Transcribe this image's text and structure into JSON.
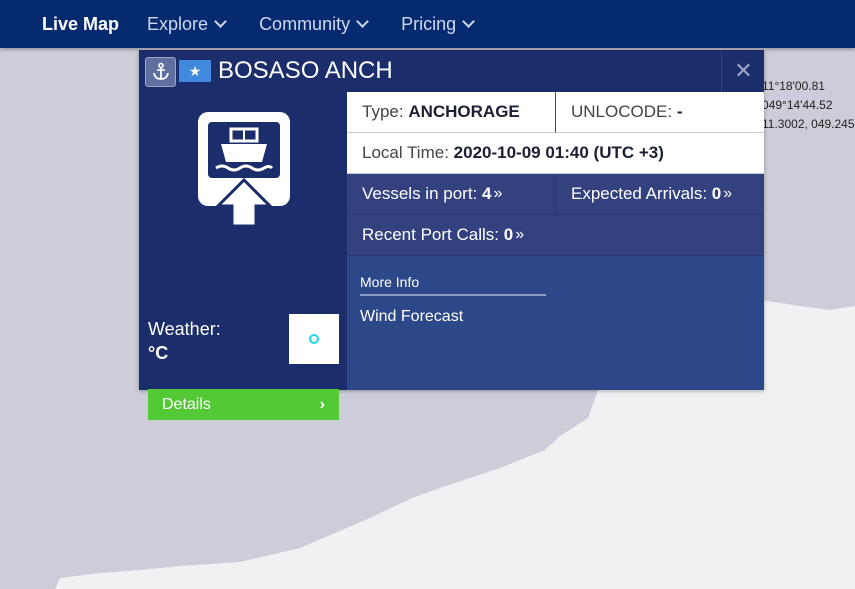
{
  "nav": {
    "items": [
      {
        "label": "Live Map",
        "active": true,
        "dropdown": false
      },
      {
        "label": "Explore",
        "active": false,
        "dropdown": true
      },
      {
        "label": "Community",
        "active": false,
        "dropdown": true
      },
      {
        "label": "Pricing",
        "active": false,
        "dropdown": true
      }
    ]
  },
  "map": {
    "coords": [
      "11°18'00.81",
      "049°14'44.52",
      "11.3002, 049.245"
    ],
    "sea_color": "#cdcdd9",
    "land_color": "#f1f1f3"
  },
  "popup": {
    "port_name": "BOSASO ANCH",
    "type_label": "Type:",
    "type_value": "ANCHORAGE",
    "unlocode_label": "UNLOCODE:",
    "unlocode_value": "-",
    "local_time_label": "Local Time:",
    "local_time_value": "2020-10-09 01:40 (UTC +3)",
    "vessels_label": "Vessels in port:",
    "vessels_value": "4",
    "arrivals_label": "Expected Arrivals:",
    "arrivals_value": "0",
    "recent_label": "Recent Port Calls:",
    "recent_value": "0",
    "weather_label": "Weather:",
    "weather_unit": "°C",
    "details_label": "Details",
    "more_info_label": "More Info",
    "wind_forecast_label": "Wind Forecast",
    "icons": {
      "anchor": "anchor-icon",
      "flag": "somalia-flag-icon",
      "close": "close-icon",
      "port": "port-ship-icon"
    },
    "colors": {
      "header": "#1b2d6b",
      "details_button": "#53c935",
      "flag": "#4189dd"
    }
  }
}
